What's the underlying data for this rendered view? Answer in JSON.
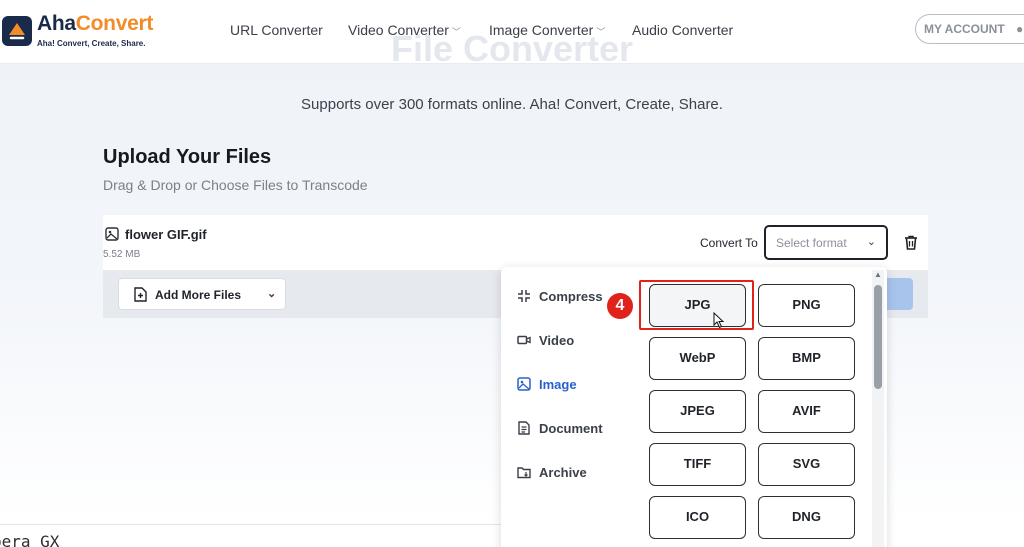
{
  "header": {
    "logo": {
      "name_part1": "Aha",
      "name_part2": "Convert",
      "tagline": "Aha! Convert, Create, Share."
    },
    "nav": [
      {
        "label": "URL Converter",
        "has_dropdown": false
      },
      {
        "label": "Video Converter",
        "has_dropdown": true
      },
      {
        "label": "Image Converter",
        "has_dropdown": true
      },
      {
        "label": "Audio Converter",
        "has_dropdown": false
      }
    ],
    "background_title": "File Converter",
    "account_label": "MY ACCOUNT"
  },
  "main": {
    "subtitle": "Supports over 300 formats online. Aha! Convert, Create, Share.",
    "upload_title": "Upload Your Files",
    "upload_subtitle": "Drag & Drop or Choose Files to Transcode",
    "file": {
      "name": "flower GIF.gif",
      "size": "5.52 MB",
      "convert_to_label": "Convert To",
      "select_placeholder": "Select format"
    },
    "add_more_label": "Add More Files"
  },
  "dropdown": {
    "categories": [
      {
        "label": "Compress",
        "icon": "compress-icon",
        "active": false
      },
      {
        "label": "Video",
        "icon": "video-icon",
        "active": false
      },
      {
        "label": "Image",
        "icon": "image-icon",
        "active": true
      },
      {
        "label": "Document",
        "icon": "document-icon",
        "active": false
      },
      {
        "label": "Archive",
        "icon": "archive-icon",
        "active": false
      }
    ],
    "formats": [
      "JPG",
      "PNG",
      "WebP",
      "BMP",
      "JPEG",
      "AVIF",
      "TIFF",
      "SVG",
      "ICO",
      "DNG"
    ],
    "hovered_format": "JPG",
    "step_number": "4"
  },
  "footer_text": "pera GX",
  "colors": {
    "brand_dark": "#1a2a4a",
    "brand_orange": "#f28c28",
    "active_category": "#2a62c9",
    "annotation_red": "#e0221a"
  }
}
